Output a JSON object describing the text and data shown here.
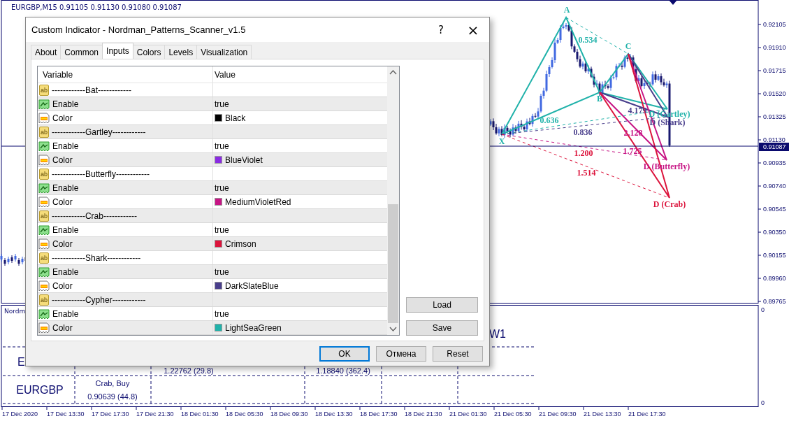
{
  "chart": {
    "header": "EURGBP,M15  0.91105 0.91130 0.91080 0.91087",
    "price_axis": [
      "0.92105",
      "0.91910",
      "0.91715",
      "0.91520",
      "0.91325",
      "0.91130",
      "0.90935",
      "0.90740",
      "0.90545",
      "0.90350",
      "0.90155",
      "0.89960",
      "0.89765"
    ],
    "current_price": "0.91087",
    "pattern_labels": [
      {
        "text": "A",
        "color": "#20b2aa"
      },
      {
        "text": "0.534",
        "color": "#20b2aa"
      },
      {
        "text": "C",
        "color": "#20b2aa"
      },
      {
        "text": "B",
        "color": "#20b2aa"
      },
      {
        "text": "0.636",
        "color": "#20b2aa"
      },
      {
        "text": "4.179",
        "color": "#483d8b"
      },
      {
        "text": "D (Gartley)",
        "color": "#20b2aa"
      },
      {
        "text": "D (Shark)",
        "color": "#483d8b"
      },
      {
        "text": "0.836",
        "color": "#483d8b"
      },
      {
        "text": "2.128",
        "color": "#c71585"
      },
      {
        "text": "X",
        "color": "#20b2aa"
      },
      {
        "text": "1.200",
        "color": "#dc143c"
      },
      {
        "text": "1.725",
        "color": "#c71585"
      },
      {
        "text": "D (Butterfly)",
        "color": "#c71585"
      },
      {
        "text": "1.514",
        "color": "#dc143c"
      },
      {
        "text": "D (Crab)",
        "color": "#dc143c"
      }
    ],
    "indicator_axis": [
      "0",
      "0"
    ],
    "time_axis": [
      "17 Dec 2020",
      "17 Dec 13:30",
      "17 Dec 17:30",
      "17 Dec 21:30",
      "18 Dec 01:30",
      "18 Dec 05:30",
      "18 Dec 09:30",
      "18 Dec 13:30",
      "18 Dec 17:30",
      "18 Dec 21:30",
      "21 Dec 01:30",
      "21 Dec 05:30",
      "21 Dec 09:30",
      "21 Dec 13:30",
      "21 Dec 17:30"
    ]
  },
  "indicator_panel": {
    "name": "Nordm",
    "column_header": "W1",
    "cells": [
      {
        "kind": "symbol",
        "text": "E"
      },
      {
        "kind": "price",
        "text": "1.22762 (29.8)"
      },
      {
        "kind": "price",
        "text": "1.18840 (362.4)"
      },
      {
        "kind": "symbol",
        "text": "EURGBP"
      },
      {
        "kind": "signal",
        "text": "Crab, Buy"
      },
      {
        "kind": "signal-price",
        "text": "0.90639 (44.8)"
      }
    ]
  },
  "dialog": {
    "title": "Custom Indicator - Nordman_Patterns_Scanner_v1.5",
    "help": "?",
    "close": "×",
    "tabs": [
      {
        "label": "About",
        "selected": false
      },
      {
        "label": "Common",
        "selected": false
      },
      {
        "label": "Inputs",
        "selected": true
      },
      {
        "label": "Colors",
        "selected": false
      },
      {
        "label": "Levels",
        "selected": false
      },
      {
        "label": "Visualization",
        "selected": false
      }
    ],
    "columns": [
      "Variable",
      "Value"
    ],
    "rows": [
      {
        "kind": "header",
        "icon_label": "ab",
        "variable": "------------Bat------------"
      },
      {
        "kind": "bool",
        "variable": "Enable",
        "value": "true"
      },
      {
        "kind": "color",
        "variable": "Color",
        "value": "Black",
        "color": "#000000"
      },
      {
        "kind": "header",
        "icon_label": "ab",
        "variable": "------------Gartley------------"
      },
      {
        "kind": "bool",
        "variable": "Enable",
        "value": "true"
      },
      {
        "kind": "color",
        "variable": "Color",
        "value": "BlueViolet",
        "color": "#8a2be2"
      },
      {
        "kind": "header",
        "icon_label": "ab",
        "variable": "------------Butterfly------------"
      },
      {
        "kind": "bool",
        "variable": "Enable",
        "value": "true"
      },
      {
        "kind": "color",
        "variable": "Color",
        "value": "MediumVioletRed",
        "color": "#c71585"
      },
      {
        "kind": "header",
        "icon_label": "ab",
        "variable": "------------Crab------------"
      },
      {
        "kind": "bool",
        "variable": "Enable",
        "value": "true"
      },
      {
        "kind": "color",
        "variable": "Color",
        "value": "Crimson",
        "color": "#dc143c"
      },
      {
        "kind": "header",
        "icon_label": "ab",
        "variable": "------------Shark------------"
      },
      {
        "kind": "bool",
        "variable": "Enable",
        "value": "true"
      },
      {
        "kind": "color",
        "variable": "Color",
        "value": "DarkSlateBlue",
        "color": "#483d8b"
      },
      {
        "kind": "header",
        "icon_label": "ab",
        "variable": "------------Cypher------------"
      },
      {
        "kind": "bool",
        "variable": "Enable",
        "value": "true"
      },
      {
        "kind": "color",
        "variable": "Color",
        "value": "LightSeaGreen",
        "color": "#20b2aa"
      }
    ],
    "side_buttons": [
      "Load",
      "Save"
    ],
    "buttons": [
      {
        "label": "OK",
        "kind": "default"
      },
      {
        "label": "Отмена",
        "kind": "normal"
      },
      {
        "label": "Reset",
        "kind": "normal"
      }
    ]
  }
}
